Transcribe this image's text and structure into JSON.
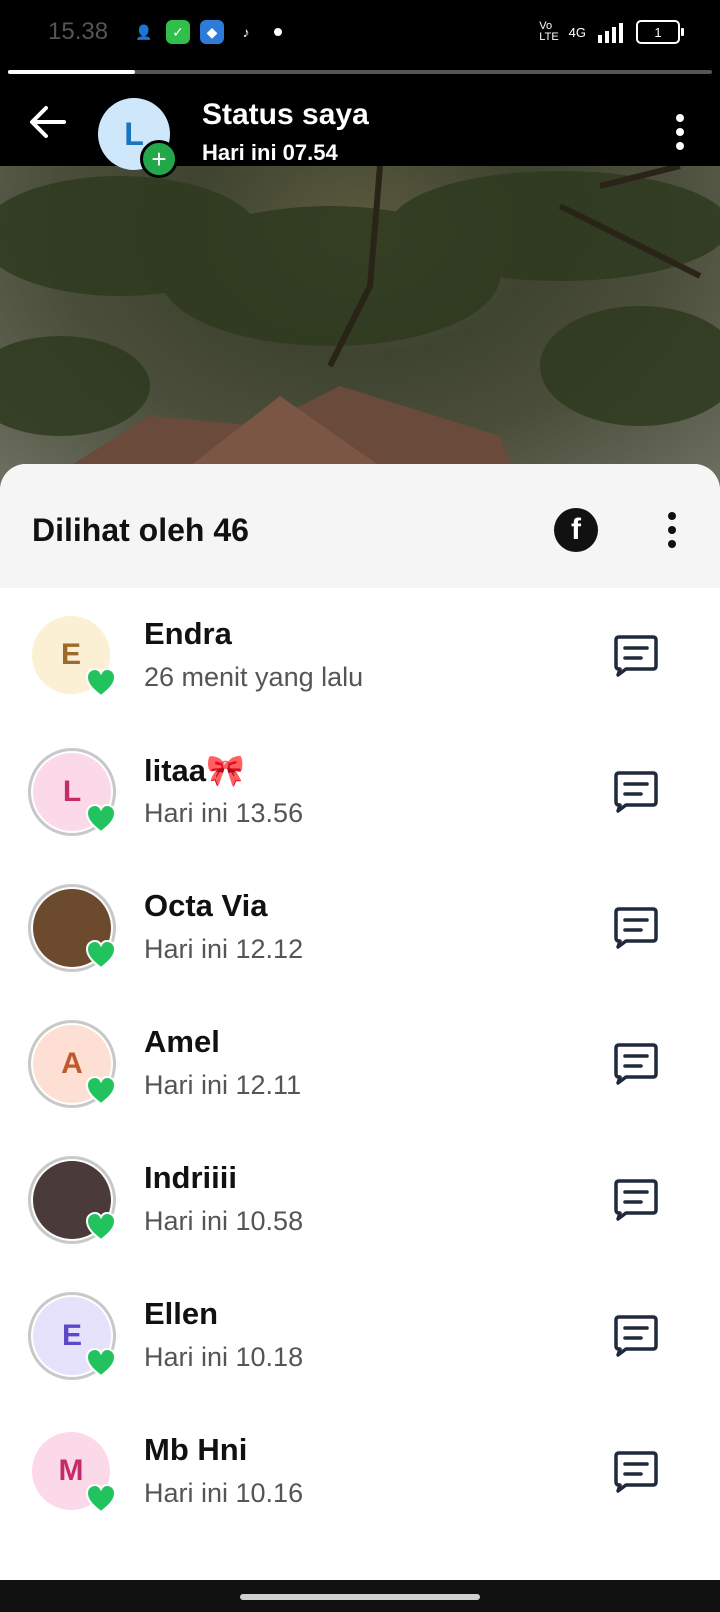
{
  "status_bar": {
    "time": "15.38",
    "battery_level": "1",
    "network": "4G"
  },
  "story_progress": 0.18,
  "header": {
    "avatar_letter": "L",
    "title": "Status saya",
    "subtitle": "Hari ini 07.54"
  },
  "sheet": {
    "title": "Dilihat oleh 46"
  },
  "viewers": [
    {
      "name": "Endra",
      "time": "26 menit yang lalu",
      "avatar_letter": "E",
      "avatar_bg": "#fbefd4",
      "avatar_fg": "#9b6a2c",
      "ring": false
    },
    {
      "name": "litaa🎀",
      "time": "Hari ini 13.56",
      "avatar_letter": "L",
      "avatar_bg": "#fbd9e8",
      "avatar_fg": "#c72a6a",
      "ring": true
    },
    {
      "name": "Octa Via",
      "time": "Hari ini 12.12",
      "avatar_letter": "",
      "avatar_bg": "#6b4a2e",
      "avatar_fg": "#ffffff",
      "ring": true
    },
    {
      "name": "Amel",
      "time": "Hari ini 12.11",
      "avatar_letter": "A",
      "avatar_bg": "#fde0d3",
      "avatar_fg": "#c05a2c",
      "ring": true
    },
    {
      "name": "Indriiii",
      "time": "Hari ini 10.58",
      "avatar_letter": "",
      "avatar_bg": "#4a3a3a",
      "avatar_fg": "#ffffff",
      "ring": true
    },
    {
      "name": "Ellen",
      "time": "Hari ini 10.18",
      "avatar_letter": "E",
      "avatar_bg": "#e6e2fb",
      "avatar_fg": "#5b49c9",
      "ring": true
    },
    {
      "name": "Mb Hni",
      "time": "Hari ini 10.16",
      "avatar_letter": "M",
      "avatar_bg": "#fbd9e8",
      "avatar_fg": "#c72a6a",
      "ring": false
    }
  ],
  "colors": {
    "accent_green": "#22c35e",
    "icon_dark": "#1f2a3a"
  }
}
